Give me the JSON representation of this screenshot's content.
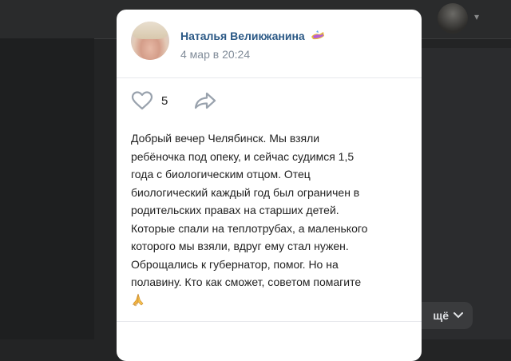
{
  "post": {
    "author_name": "Наталья Великжанина",
    "author_badge_icon": "gift-icon",
    "date": "4 мар в 20:24",
    "likes_count": "5",
    "text_lines": [
      "Добрый вечер Челябинск. Мы взяли",
      "ребёночка под опеку, и сейчас судимся 1,5",
      "года с биологическим отцом. Отец",
      "биологический каждый год был ограничен в",
      "родительских правах на старших детей.",
      "Которые спали на теплотрубах, а маленького",
      "которого мы взяли, вдруг ему стал нужен.",
      "Оброщались к губернатор, помог. Но на",
      "полавину. Кто как сможет, советом помагите"
    ],
    "emoji": "🙏"
  },
  "background": {
    "more_label": "щё",
    "more_icon": "chevron-down-icon"
  },
  "colors": {
    "link": "#2a5885",
    "secondary_text": "#818c99",
    "card_bg": "#ffffff",
    "page_bg": "#232425"
  }
}
